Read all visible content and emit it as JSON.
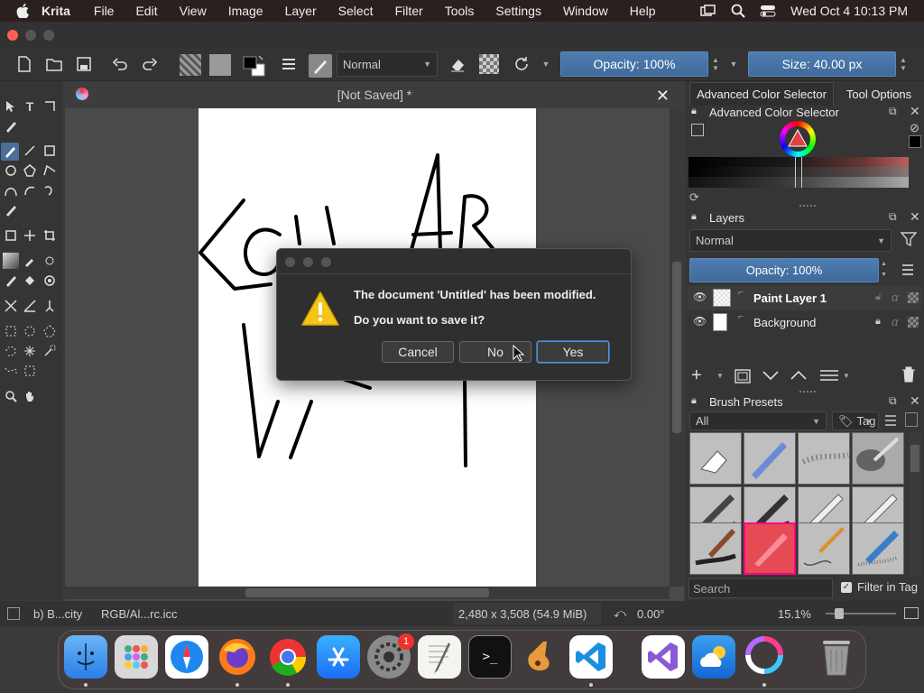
{
  "mac_menubar": {
    "app_name": "Krita",
    "menus": [
      "File",
      "Edit",
      "View",
      "Image",
      "Layer",
      "Select",
      "Filter",
      "Tools",
      "Settings",
      "Window",
      "Help"
    ],
    "clock": "Wed Oct 4  10:13 PM"
  },
  "toolbar": {
    "blend_mode": "Normal",
    "opacity_label": "Opacity: 100%",
    "size_label": "Size: 40.00 px"
  },
  "document": {
    "tab_title": "[Not Saved]  *"
  },
  "dialog": {
    "line1": "The document 'Untitled' has been modified.",
    "line2": "Do you want to save it?",
    "cancel": "Cancel",
    "no": "No",
    "yes": "Yes"
  },
  "dockers": {
    "tabs": [
      "Advanced Color Selector",
      "Tool Options"
    ],
    "color_selector_title": "Advanced Color Selector",
    "layers_title": "Layers",
    "layers_blend": "Normal",
    "layers_opacity": "Opacity:  100%",
    "layers": [
      {
        "name": "Paint Layer 1",
        "selected": true
      },
      {
        "name": "Background",
        "selected": false
      }
    ],
    "brush_presets_title": "Brush Presets",
    "brush_filter": "All",
    "tag_label": "Tag",
    "search_placeholder": "Search",
    "filter_in_tag": "Filter in Tag"
  },
  "statusbar": {
    "brush_name": "b) B...city",
    "color_profile": "RGB/Al...rc.icc",
    "image_size": "2,480 x 3,508 (54.9 MiB)",
    "rotation": "0.00°",
    "zoom": "15.1%"
  },
  "notification_badge": "1",
  "colors": {
    "accent_blue": "#4a78ad",
    "brush_selected": "#e64a55",
    "warning_yellow": "#f5c518"
  }
}
